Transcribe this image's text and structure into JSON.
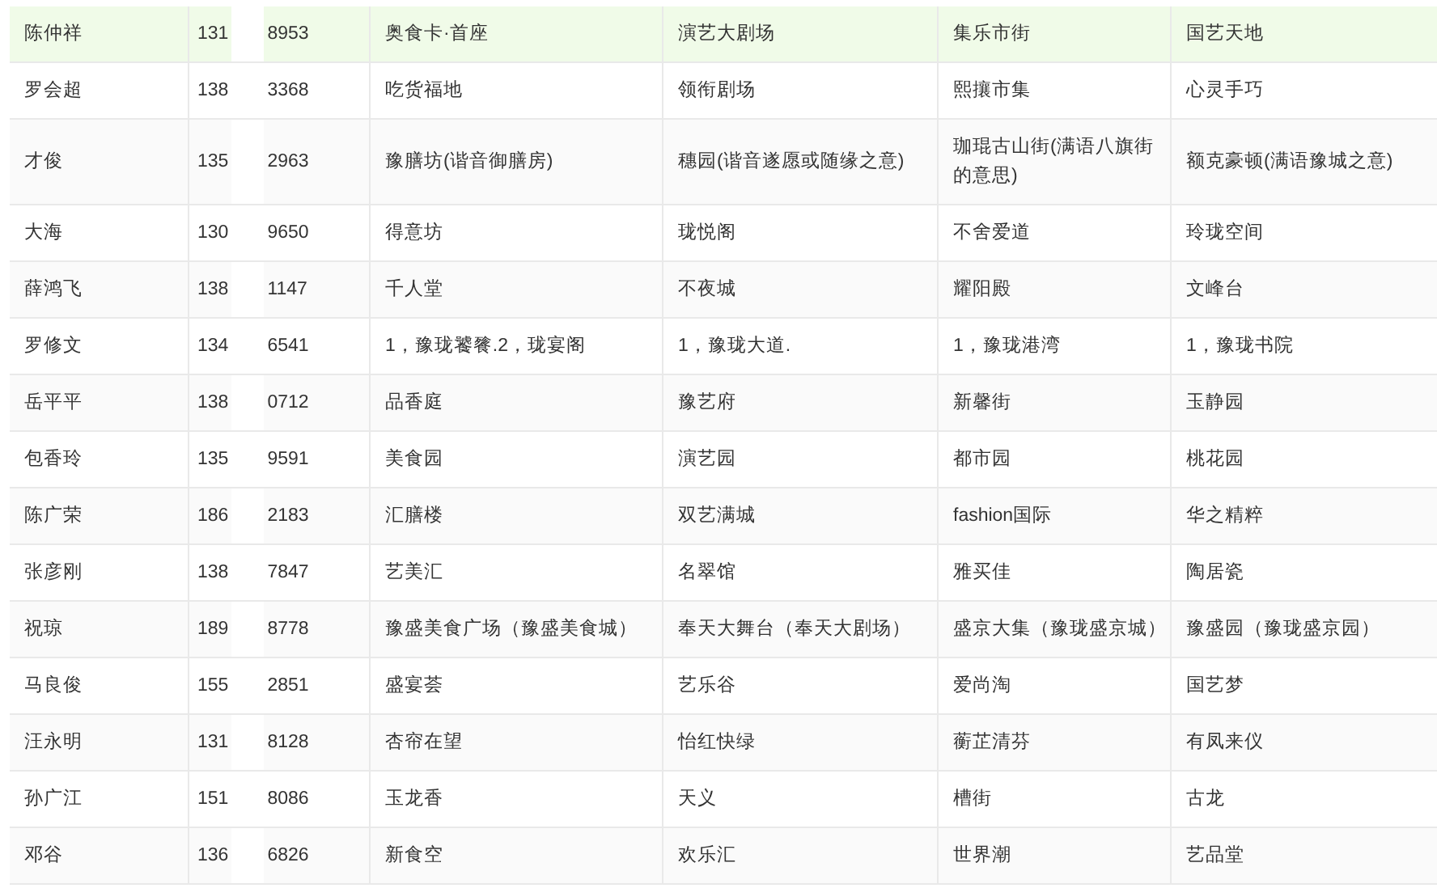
{
  "rows": [
    {
      "highlighted": true,
      "name": "陈仲祥",
      "phone_start": "131",
      "phone_end": "8953",
      "column_3": "奥食卡·首座",
      "column_4": "演艺大剧场",
      "column_5": "集乐市街",
      "column_6": "国艺天地"
    },
    {
      "highlighted": false,
      "name": "罗会超",
      "phone_start": "138",
      "phone_end": "3368",
      "column_3": "吃货福地",
      "column_4": "领衔剧场",
      "column_5": "熙攘市集",
      "column_6": "心灵手巧"
    },
    {
      "highlighted": false,
      "name": "才俊",
      "phone_start": "135",
      "phone_end": "2963",
      "column_3": "豫膳坊(谐音御膳房)",
      "column_4": "穗园(谐音遂愿或随缘之意)",
      "column_5": "珈琨古山街(满语八旗街的意思)",
      "column_6": "额克豪顿(满语豫城之意)"
    },
    {
      "highlighted": false,
      "name": "大海",
      "phone_start": "130",
      "phone_end": "9650",
      "column_3": "得意坊",
      "column_4": "珑悦阁",
      "column_5": "不舍爱道",
      "column_6": "玲珑空间"
    },
    {
      "highlighted": false,
      "name": "薛鸿飞",
      "phone_start": "138",
      "phone_end": "1147",
      "column_3": "千人堂",
      "column_4": "不夜城",
      "column_5": "耀阳殿",
      "column_6": "文峰台"
    },
    {
      "highlighted": false,
      "name": "罗修文",
      "phone_start": "134",
      "phone_end": "6541",
      "column_3": "1，豫珑饕餮.2，珑宴阁",
      "column_4": "1，豫珑大道.",
      "column_5": "1，豫珑港湾",
      "column_6": "1，豫珑书院"
    },
    {
      "highlighted": false,
      "name": "岳平平",
      "phone_start": "138",
      "phone_end": "0712",
      "column_3": "品香庭",
      "column_4": "豫艺府",
      "column_5": "新馨街",
      "column_6": "玉静园"
    },
    {
      "highlighted": false,
      "name": "包香玲",
      "phone_start": "135",
      "phone_end": "9591",
      "column_3": "美食园",
      "column_4": "演艺园",
      "column_5": "都市园",
      "column_6": "桃花园"
    },
    {
      "highlighted": false,
      "name": "陈广荣",
      "phone_start": "186",
      "phone_end": "2183",
      "column_3": "汇膳楼",
      "column_4": "双艺满城",
      "column_5": "fashion国际",
      "column_6": "华之精粹"
    },
    {
      "highlighted": false,
      "name": "张彦刚",
      "phone_start": "138",
      "phone_end": "7847",
      "column_3": "艺美汇",
      "column_4": "名翠馆",
      "column_5": "雅买佳",
      "column_6": "陶居瓷"
    },
    {
      "highlighted": false,
      "name": "祝琼",
      "phone_start": "189",
      "phone_end": "8778",
      "column_3": "豫盛美食广场（豫盛美食城）",
      "column_4": "奉天大舞台（奉天大剧场）",
      "column_5": "盛京大集（豫珑盛京城）",
      "column_6": "豫盛园（豫珑盛京园）"
    },
    {
      "highlighted": false,
      "name": "马良俊",
      "phone_start": "155",
      "phone_end": "2851",
      "column_3": "盛宴荟",
      "column_4": "艺乐谷",
      "column_5": "爱尚淘",
      "column_6": "国艺梦"
    },
    {
      "highlighted": false,
      "name": "汪永明",
      "phone_start": "131",
      "phone_end": "8128",
      "column_3": "杏帘在望",
      "column_4": "怡红快绿",
      "column_5": "蘅芷清芬",
      "column_6": "有凤来仪"
    },
    {
      "highlighted": false,
      "name": "孙广江",
      "phone_start": "151",
      "phone_end": "8086",
      "column_3": "玉龙香",
      "column_4": "天义",
      "column_5": "槽街",
      "column_6": "古龙"
    },
    {
      "highlighted": false,
      "name": "邓谷",
      "phone_start": "136",
      "phone_end": "6826",
      "column_3": "新食空",
      "column_4": "欢乐汇",
      "column_5": "世界潮",
      "column_6": "艺品堂"
    }
  ]
}
